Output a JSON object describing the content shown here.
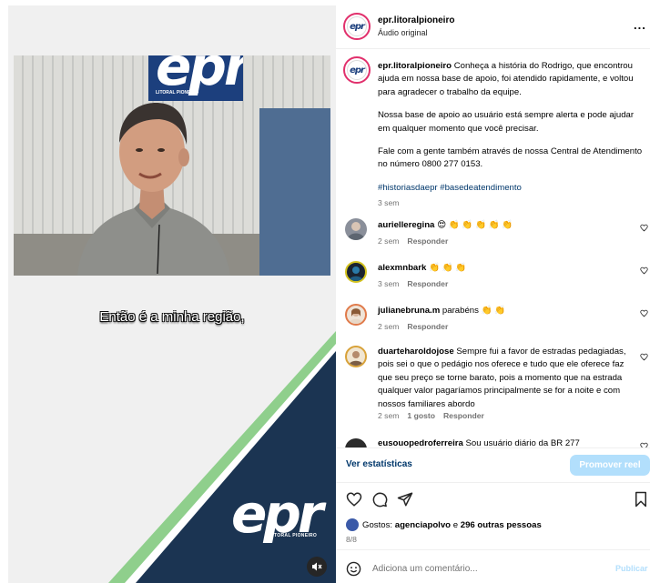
{
  "video": {
    "caption": "Então é a minha região,",
    "sign_mark": "epr",
    "sign_subtitle": "LITORAL PIONEIRO",
    "brand_logo": "epr",
    "brand_subtitle": "LITORAL PIONEIRO",
    "mute_icon": "speaker-muted-icon",
    "colors": {
      "navy": "#1b3452",
      "green": "#8fcf8c",
      "background": "#f0f0f0"
    }
  },
  "post": {
    "author": "epr.litoralpioneiro",
    "audio": "Áudio original",
    "more_label": "...",
    "caption": {
      "author": "epr.litoralpioneiro",
      "paragraphs": [
        "Conheça a história do Rodrigo, que encontrou ajuda em nossa base de apoio, foi atendido rapidamente, e voltou para agradecer o trabalho da equipe.",
        "Nossa base de apoio ao usuário está sempre alerta e pode ajudar em qualquer momento que você precisar.",
        "Fale com a gente também através de nossa Central de Atendimento no número 0800 277 0153."
      ],
      "hashtags": "#historiasdaepr #basedeatendimento",
      "time": "3 sem"
    },
    "comments": [
      {
        "user": "aurielleregina",
        "text": "😍 👏 👏 👏 👏 👏",
        "time": "2 sem",
        "reply": "Responder",
        "likes": ""
      },
      {
        "user": "alexmnbark",
        "text": "👏 👏 👏",
        "time": "3 sem",
        "reply": "Responder",
        "likes": ""
      },
      {
        "user": "julianebruna.m",
        "text": "parabéns 👏 👏",
        "time": "2 sem",
        "reply": "Responder",
        "likes": ""
      },
      {
        "user": "duarteharoldojose",
        "text": "Sempre fui a favor de estradas pedagiadas, pois sei o que o pedágio nos oferece e tudo que ele oferece faz que seu preço se torne barato, pois a momento que na estrada qualquer valor pagaríamos principalmente se for a noite e com nossos familiares abordo",
        "time": "2 sem",
        "reply": "Responder",
        "likes": "1 gosto"
      },
      {
        "user": "eusouopedroferreira",
        "text": "Sou usuário diário da BR 277",
        "time": "",
        "reply": "",
        "likes": ""
      }
    ],
    "stats_link": "Ver estatísticas",
    "promote_button": "Promover reel",
    "likes": {
      "prefix": "Gostos:",
      "first_user": "agenciapolvo",
      "connector": "e",
      "others": "296 outras pessoas"
    },
    "counter": "8/8",
    "comment_placeholder": "Adiciona um comentário...",
    "publish_label": "Publicar",
    "icons": [
      "heart-icon",
      "comment-icon",
      "share-icon",
      "bookmark-icon",
      "emoji-icon"
    ],
    "colors": {
      "link": "#00376b",
      "button": "#b2dffc",
      "muted": "#737373"
    }
  }
}
